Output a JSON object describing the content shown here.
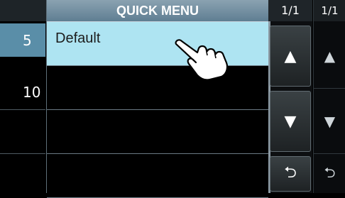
{
  "left_column": {
    "numbers": [
      "5",
      "10"
    ]
  },
  "panel": {
    "title": "QUICK MENU",
    "items": [
      "Default",
      "",
      "",
      ""
    ],
    "page_indicator": "1/1"
  },
  "right_column": {
    "page_indicator": "1/1"
  },
  "icons": {
    "up": "▲",
    "down": "▼",
    "back": "⮌"
  }
}
